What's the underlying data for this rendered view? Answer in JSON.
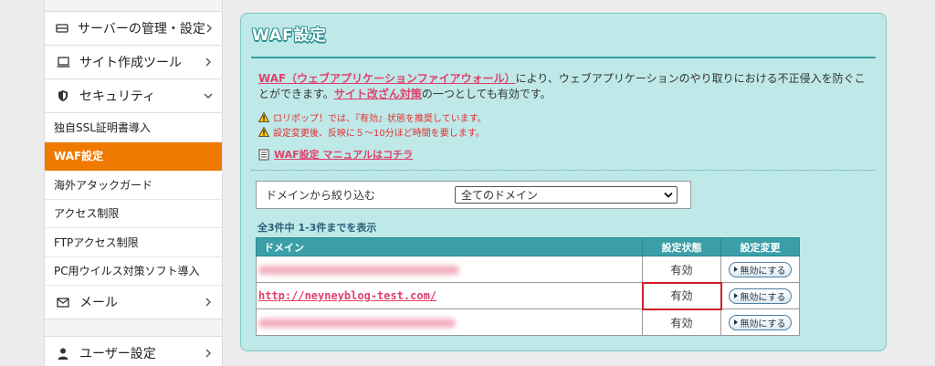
{
  "sidebar": {
    "server_settings": "サーバーの管理・設定",
    "site_tools": "サイト作成ツール",
    "security": "セキュリティ",
    "security_items": [
      "独自SSL証明書導入",
      "WAF設定",
      "海外アタックガード",
      "アクセス制限",
      "FTPアクセス制限",
      "PC用ウイルス対策ソフト導入"
    ],
    "mail": "メール",
    "user_settings": "ユーザー設定"
  },
  "panel": {
    "title": "WAF設定",
    "intro_link1": "WAF（ウェブアプリケーションファイアウォール）",
    "intro_text1": "により、ウェブアプリケーションのやり取りにおける不正侵入を防ぐことができます。",
    "intro_link2": "サイト改ざん対策",
    "intro_text2": "の一つとしても有効です。",
    "warning1": "ロリポップ！では、『有効』状態を推奨しています。",
    "warning2": "設定変更後、反映に５～10分ほど時間を要します。",
    "manual_link": "WAF設定 マニュアルはコチラ",
    "filter_label": "ドメインから絞り込む",
    "filter_selected": "全てのドメイン",
    "count_text": "全3件中 1-3件までを表示",
    "table": {
      "headers": [
        "ドメイン",
        "設定状態",
        "設定変更"
      ],
      "rows": [
        {
          "domain": "",
          "status": "有効",
          "action": "無効にする"
        },
        {
          "domain": "http://neyneyblog-test.com/",
          "status": "有効",
          "action": "無効にする"
        },
        {
          "domain": "",
          "status": "有効",
          "action": "無効にする"
        }
      ]
    }
  }
}
